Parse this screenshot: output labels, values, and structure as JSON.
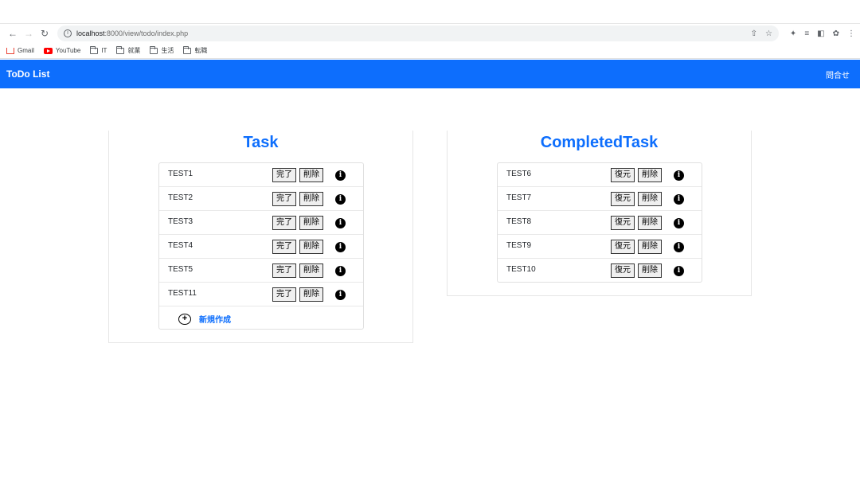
{
  "browser": {
    "url_host": "localhost",
    "url_rest": ":8000/view/todo/index.php",
    "bookmarks": [
      {
        "label": "Gmail",
        "icon": "gmail-icon"
      },
      {
        "label": "YouTube",
        "icon": "youtube-icon"
      },
      {
        "label": "IT",
        "icon": "folder-icon"
      },
      {
        "label": "就業",
        "icon": "folder-icon"
      },
      {
        "label": "生活",
        "icon": "folder-icon"
      },
      {
        "label": "転職",
        "icon": "folder-icon"
      }
    ]
  },
  "navbar": {
    "brand": "ToDo List",
    "contact": "問合せ",
    "color": "#0d6efd"
  },
  "task": {
    "title": "Task",
    "complete_label": "完了",
    "delete_label": "削除",
    "items": [
      "TEST1",
      "TEST2",
      "TEST3",
      "TEST4",
      "TEST5",
      "TEST11"
    ],
    "new_label": "新規作成"
  },
  "completed": {
    "title": "CompletedTask",
    "restore_label": "復元",
    "delete_label": "削除",
    "items": [
      "TEST6",
      "TEST7",
      "TEST8",
      "TEST9",
      "TEST10"
    ]
  }
}
